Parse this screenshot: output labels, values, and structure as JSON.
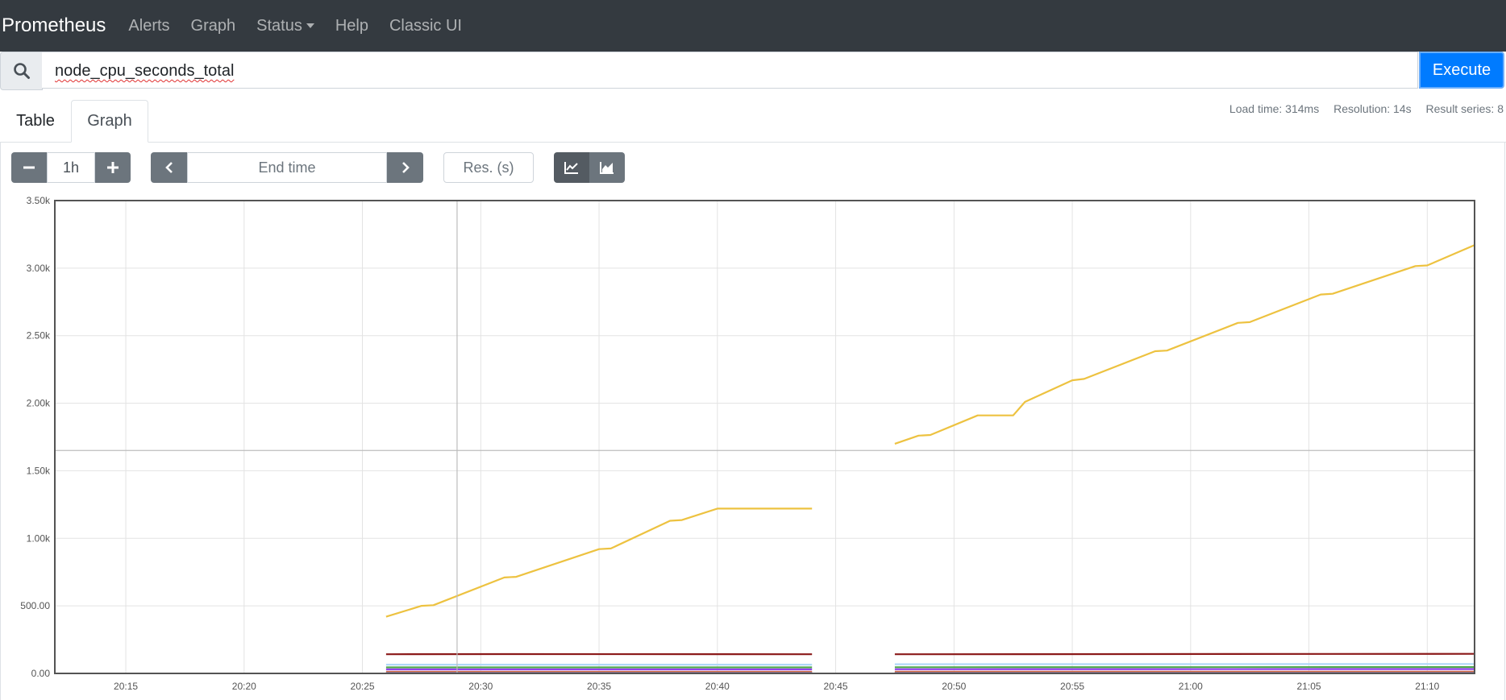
{
  "navbar": {
    "brand": "Prometheus",
    "items": [
      "Alerts",
      "Graph",
      "Status",
      "Help",
      "Classic UI"
    ]
  },
  "query": {
    "search_icon": "search-icon",
    "expression": "node_cpu_seconds_total",
    "execute_label": "Execute"
  },
  "tabs": {
    "table": "Table",
    "graph": "Graph"
  },
  "stats": {
    "load_time": "Load time: 314ms",
    "resolution": "Resolution: 14s",
    "result_series": "Result series: 8"
  },
  "controls": {
    "range": "1h",
    "end_time_placeholder": "End time",
    "res_placeholder": "Res. (s)",
    "icons": [
      "minus-icon",
      "plus-icon",
      "chevron-left-icon",
      "chevron-right-icon",
      "line-chart-icon",
      "stacked-chart-icon"
    ]
  },
  "chart_data": {
    "type": "line",
    "x_ticks": [
      "20:15",
      "20:20",
      "20:25",
      "20:30",
      "20:35",
      "20:40",
      "20:45",
      "20:50",
      "20:55",
      "21:00",
      "21:05",
      "21:10"
    ],
    "y_ticks": [
      "0.00",
      "500.00",
      "1.00k",
      "1.50k",
      "2.00k",
      "2.50k",
      "3.00k",
      "3.50k"
    ],
    "x_range": [
      "20:12",
      "21:12"
    ],
    "ylim": [
      0,
      3500
    ],
    "grid": true,
    "series": [
      {
        "color": "#edc240",
        "segments": [
          [
            [
              "20:26",
              420
            ],
            [
              "20:27:30",
              500
            ],
            [
              "20:28",
              505
            ],
            [
              "20:31",
              710
            ],
            [
              "20:31:30",
              715
            ],
            [
              "20:35",
              920
            ],
            [
              "20:35:30",
              925
            ],
            [
              "20:38",
              1130
            ],
            [
              "20:38:30",
              1135
            ],
            [
              "20:40",
              1220
            ],
            [
              "20:44",
              1220
            ]
          ],
          [
            [
              "20:47:30",
              1700
            ],
            [
              "20:48:30",
              1760
            ],
            [
              "20:49",
              1765
            ],
            [
              "20:51",
              1910
            ],
            [
              "20:52:30",
              1910
            ],
            [
              "20:53",
              2010
            ],
            [
              "20:55",
              2170
            ],
            [
              "20:55:30",
              2180
            ],
            [
              "20:58:30",
              2385
            ],
            [
              "20:59",
              2390
            ],
            [
              "21:02",
              2595
            ],
            [
              "21:02:30",
              2600
            ],
            [
              "21:05:30",
              2805
            ],
            [
              "21:06",
              2810
            ],
            [
              "21:09:30",
              3015
            ],
            [
              "21:10",
              3020
            ],
            [
              "21:12",
              3170
            ]
          ]
        ]
      },
      {
        "color": "#8b1a1a",
        "segments": [
          [
            [
              "20:26",
              142
            ],
            [
              "20:31",
              143
            ],
            [
              "20:44",
              142
            ]
          ],
          [
            [
              "20:47:30",
              142
            ],
            [
              "21:12",
              145
            ]
          ]
        ]
      },
      {
        "color": "#afd8f8",
        "segments": [
          [
            [
              "20:26",
              65
            ],
            [
              "20:44",
              65
            ]
          ],
          [
            [
              "20:47:30",
              68
            ],
            [
              "21:12",
              70
            ]
          ]
        ]
      },
      {
        "color": "#4da74d",
        "segments": [
          [
            [
              "20:26",
              45
            ],
            [
              "20:44",
              45
            ]
          ],
          [
            [
              "20:47:30",
              46
            ],
            [
              "21:12",
              47
            ]
          ]
        ]
      },
      {
        "color": "#9440ed",
        "segments": [
          [
            [
              "20:26",
              30
            ],
            [
              "20:44",
              30
            ]
          ],
          [
            [
              "20:47:30",
              31
            ],
            [
              "21:12",
              32
            ]
          ]
        ]
      },
      {
        "color": "#cb4b4b",
        "segments": [
          [
            [
              "20:26",
              12
            ],
            [
              "20:44",
              12
            ]
          ],
          [
            [
              "20:47:30",
              13
            ],
            [
              "21:12",
              13
            ]
          ]
        ]
      },
      {
        "color": "#e0a030",
        "segments": [
          [
            [
              "20:26",
              8
            ],
            [
              "20:44",
              8
            ]
          ],
          [
            [
              "20:47:30",
              8
            ],
            [
              "21:12",
              8
            ]
          ]
        ]
      },
      {
        "color": "#6a5acd",
        "segments": [
          [
            [
              "20:26",
              3
            ],
            [
              "20:44",
              3
            ]
          ],
          [
            [
              "20:47:30",
              3
            ],
            [
              "21:12",
              3
            ]
          ]
        ]
      }
    ],
    "crosshair": {
      "x": "20:29",
      "y": 1650
    }
  }
}
